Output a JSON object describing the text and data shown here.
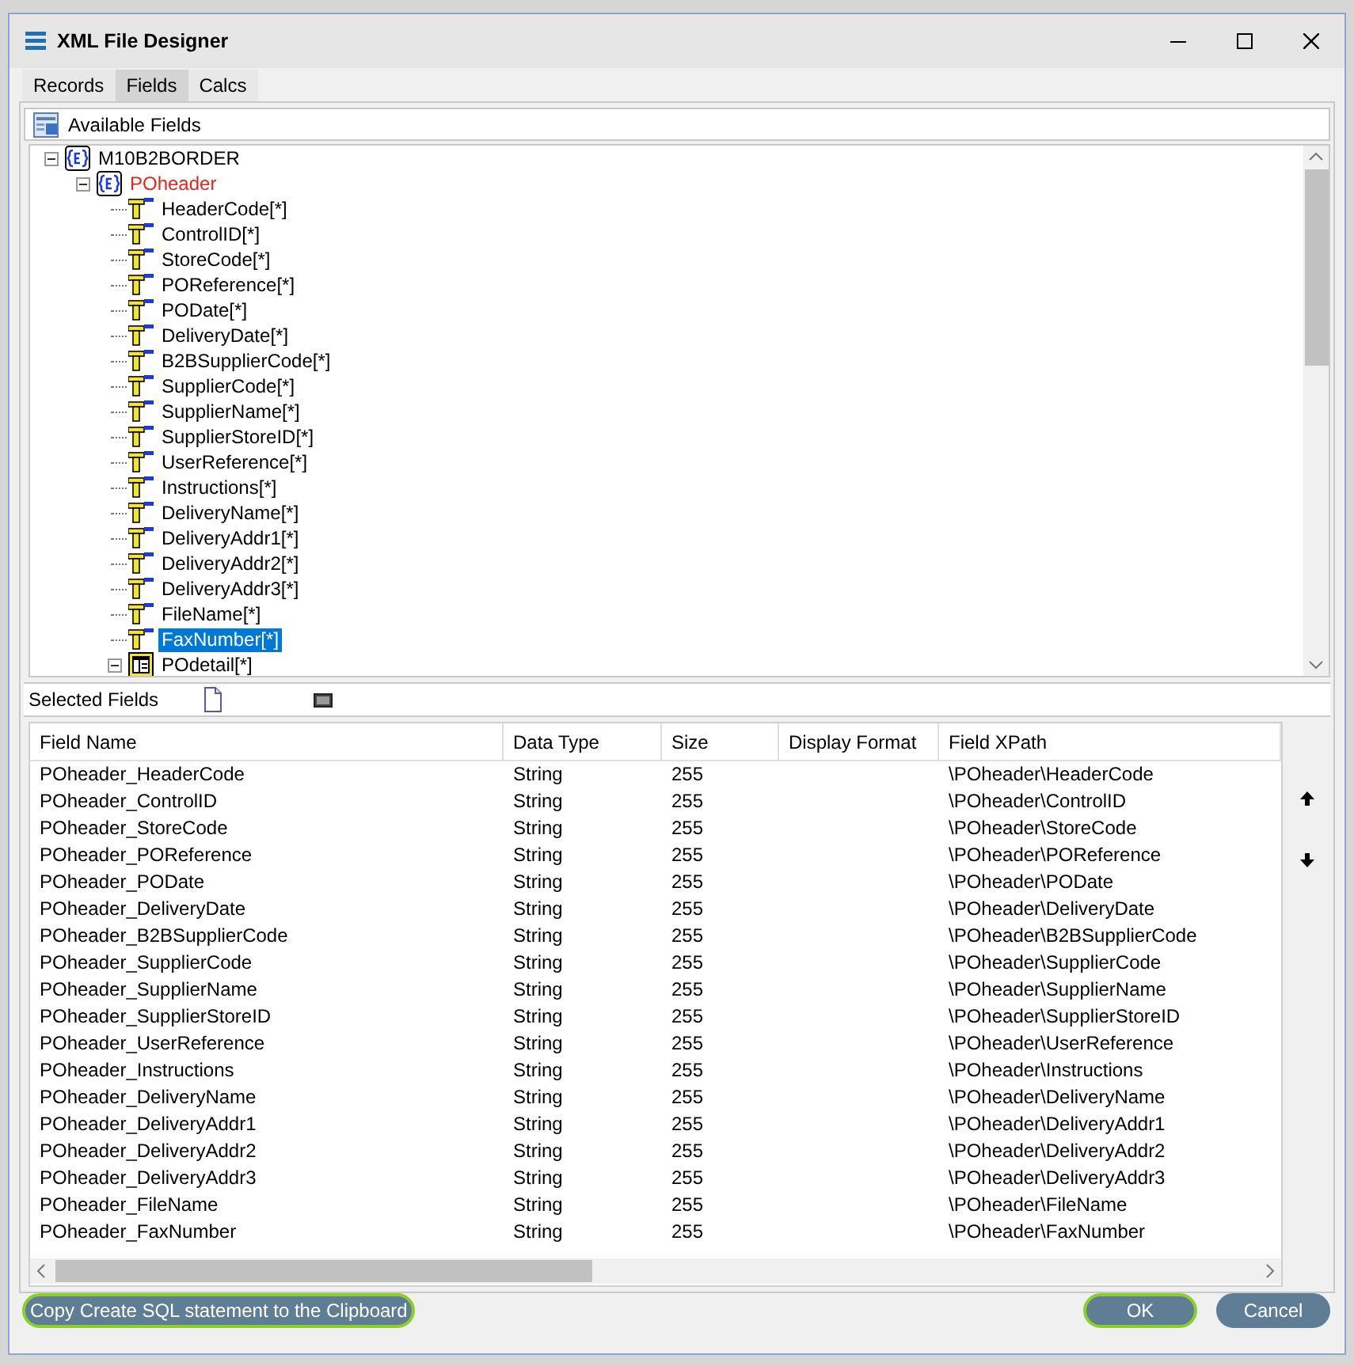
{
  "window": {
    "title": "XML File Designer"
  },
  "tabs": [
    {
      "label": "Records",
      "selected": false
    },
    {
      "label": "Fields",
      "selected": true
    },
    {
      "label": "Calcs",
      "selected": false
    }
  ],
  "available_fields": {
    "title": "Available Fields",
    "tree": [
      {
        "label": "M10B2BORDER",
        "kind": "element",
        "expanded": true,
        "selected": false,
        "highlighted": false,
        "children": [
          {
            "label": "POheader",
            "kind": "element",
            "expanded": true,
            "selected": false,
            "highlighted": true,
            "children": [
              {
                "label": "HeaderCode[*]",
                "kind": "field",
                "selected": false,
                "highlighted": false
              },
              {
                "label": "ControlID[*]",
                "kind": "field",
                "selected": false,
                "highlighted": false
              },
              {
                "label": "StoreCode[*]",
                "kind": "field",
                "selected": false,
                "highlighted": false
              },
              {
                "label": "POReference[*]",
                "kind": "field",
                "selected": false,
                "highlighted": false
              },
              {
                "label": "PODate[*]",
                "kind": "field",
                "selected": false,
                "highlighted": false
              },
              {
                "label": "DeliveryDate[*]",
                "kind": "field",
                "selected": false,
                "highlighted": false
              },
              {
                "label": "B2BSupplierCode[*]",
                "kind": "field",
                "selected": false,
                "highlighted": false
              },
              {
                "label": "SupplierCode[*]",
                "kind": "field",
                "selected": false,
                "highlighted": false
              },
              {
                "label": "SupplierName[*]",
                "kind": "field",
                "selected": false,
                "highlighted": false
              },
              {
                "label": "SupplierStoreID[*]",
                "kind": "field",
                "selected": false,
                "highlighted": false
              },
              {
                "label": "UserReference[*]",
                "kind": "field",
                "selected": false,
                "highlighted": false
              },
              {
                "label": "Instructions[*]",
                "kind": "field",
                "selected": false,
                "highlighted": false
              },
              {
                "label": "DeliveryName[*]",
                "kind": "field",
                "selected": false,
                "highlighted": false
              },
              {
                "label": "DeliveryAddr1[*]",
                "kind": "field",
                "selected": false,
                "highlighted": false
              },
              {
                "label": "DeliveryAddr2[*]",
                "kind": "field",
                "selected": false,
                "highlighted": false
              },
              {
                "label": "DeliveryAddr3[*]",
                "kind": "field",
                "selected": false,
                "highlighted": false
              },
              {
                "label": "FileName[*]",
                "kind": "field",
                "selected": false,
                "highlighted": false
              },
              {
                "label": "FaxNumber[*]",
                "kind": "field",
                "selected": true,
                "highlighted": false
              },
              {
                "label": "POdetail[*]",
                "kind": "table",
                "expanded": true,
                "selected": false,
                "highlighted": false
              }
            ]
          }
        ]
      }
    ]
  },
  "selected_fields": {
    "title": "Selected Fields",
    "columns": [
      "Field Name",
      "Data Type",
      "Size",
      "Display Format",
      "Field XPath"
    ],
    "rows": [
      [
        "POheader_HeaderCode",
        "String",
        "255",
        "",
        "\\POheader\\HeaderCode"
      ],
      [
        "POheader_ControlID",
        "String",
        "255",
        "",
        "\\POheader\\ControlID"
      ],
      [
        "POheader_StoreCode",
        "String",
        "255",
        "",
        "\\POheader\\StoreCode"
      ],
      [
        "POheader_POReference",
        "String",
        "255",
        "",
        "\\POheader\\POReference"
      ],
      [
        "POheader_PODate",
        "String",
        "255",
        "",
        "\\POheader\\PODate"
      ],
      [
        "POheader_DeliveryDate",
        "String",
        "255",
        "",
        "\\POheader\\DeliveryDate"
      ],
      [
        "POheader_B2BSupplierCode",
        "String",
        "255",
        "",
        "\\POheader\\B2BSupplierCode"
      ],
      [
        "POheader_SupplierCode",
        "String",
        "255",
        "",
        "\\POheader\\SupplierCode"
      ],
      [
        "POheader_SupplierName",
        "String",
        "255",
        "",
        "\\POheader\\SupplierName"
      ],
      [
        "POheader_SupplierStoreID",
        "String",
        "255",
        "",
        "\\POheader\\SupplierStoreID"
      ],
      [
        "POheader_UserReference",
        "String",
        "255",
        "",
        "\\POheader\\UserReference"
      ],
      [
        "POheader_Instructions",
        "String",
        "255",
        "",
        "\\POheader\\Instructions"
      ],
      [
        "POheader_DeliveryName",
        "String",
        "255",
        "",
        "\\POheader\\DeliveryName"
      ],
      [
        "POheader_DeliveryAddr1",
        "String",
        "255",
        "",
        "\\POheader\\DeliveryAddr1"
      ],
      [
        "POheader_DeliveryAddr2",
        "String",
        "255",
        "",
        "\\POheader\\DeliveryAddr2"
      ],
      [
        "POheader_DeliveryAddr3",
        "String",
        "255",
        "",
        "\\POheader\\DeliveryAddr3"
      ],
      [
        "POheader_FileName",
        "String",
        "255",
        "",
        "\\POheader\\FileName"
      ],
      [
        "POheader_FaxNumber",
        "String",
        "255",
        "",
        "\\POheader\\FaxNumber"
      ]
    ]
  },
  "buttons": [
    {
      "label": "Copy Create SQL statement to the Clipboard",
      "focused": true
    },
    {
      "label": "OK",
      "focused": true
    },
    {
      "label": "Cancel",
      "focused": false
    }
  ]
}
